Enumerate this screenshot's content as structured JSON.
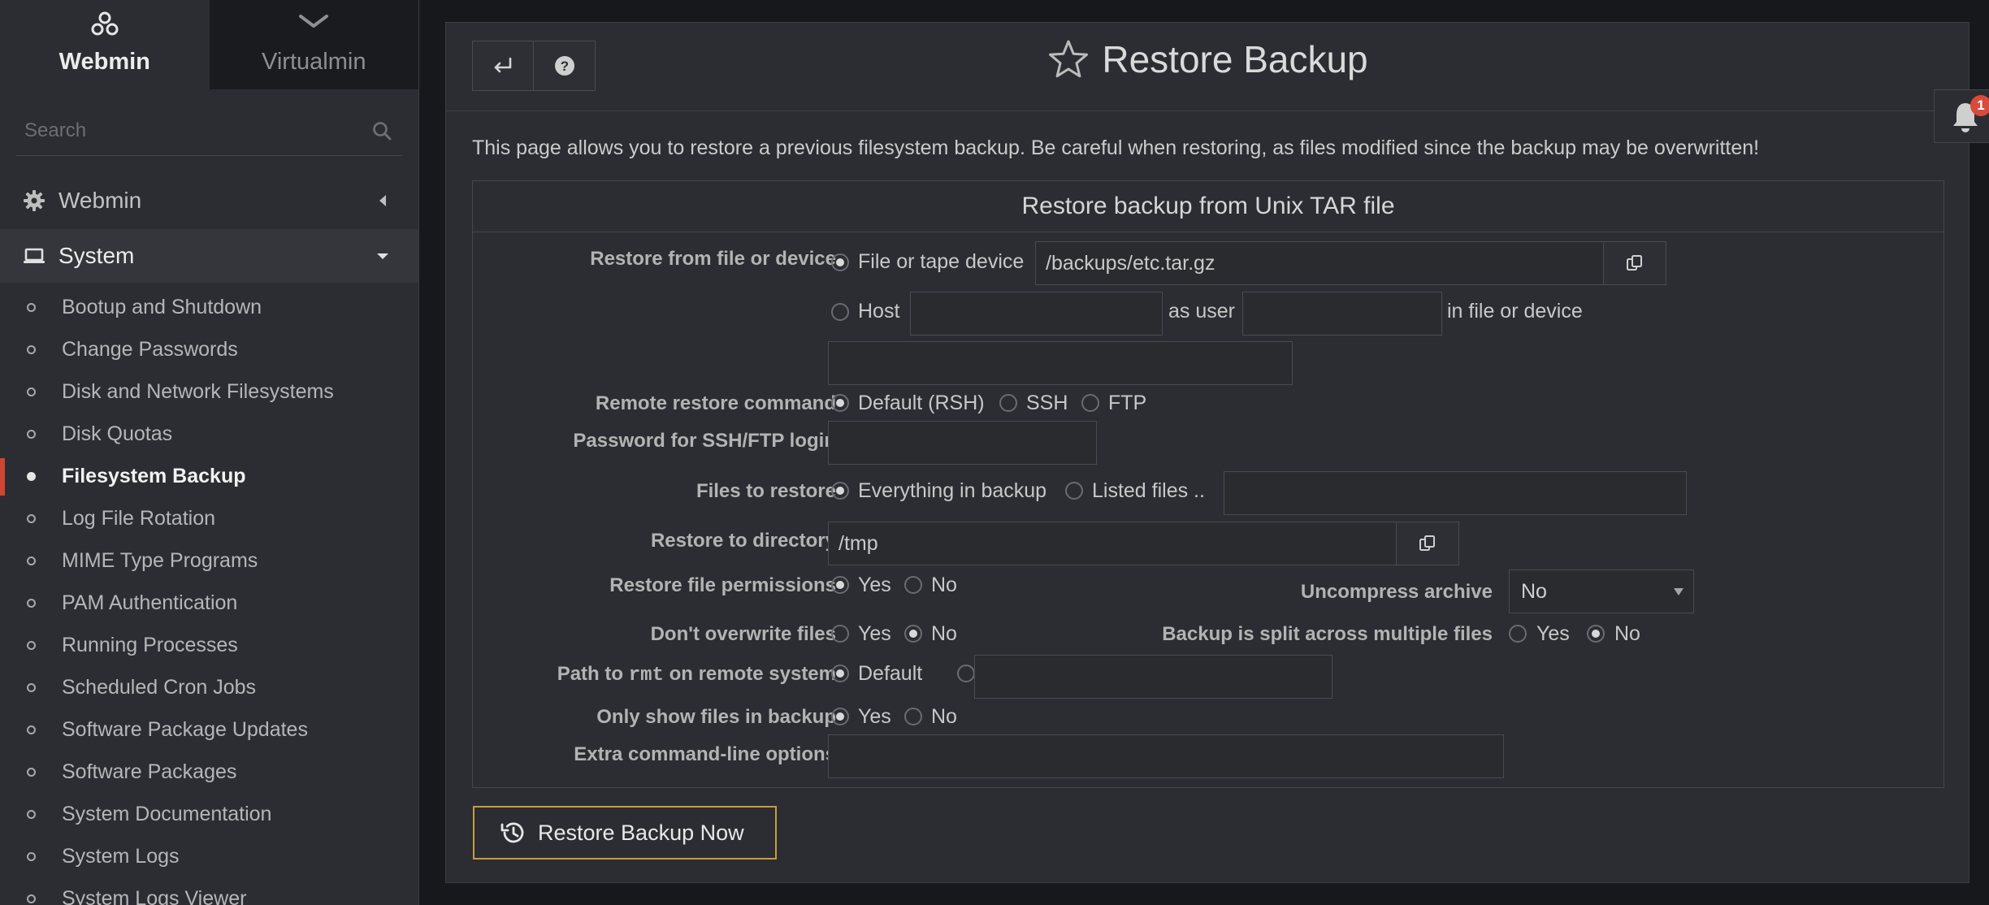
{
  "switcher": {
    "webmin_label": "Webmin",
    "virtualmin_label": "Virtualmin"
  },
  "search": {
    "placeholder": "Search"
  },
  "nav": {
    "webmin_label": "Webmin",
    "system_label": "System",
    "items": [
      {
        "label": "Bootup and Shutdown"
      },
      {
        "label": "Change Passwords"
      },
      {
        "label": "Disk and Network Filesystems"
      },
      {
        "label": "Disk Quotas"
      },
      {
        "label": "Filesystem Backup",
        "active": true
      },
      {
        "label": "Log File Rotation"
      },
      {
        "label": "MIME Type Programs"
      },
      {
        "label": "PAM Authentication"
      },
      {
        "label": "Running Processes"
      },
      {
        "label": "Scheduled Cron Jobs"
      },
      {
        "label": "Software Package Updates"
      },
      {
        "label": "Software Packages"
      },
      {
        "label": "System Documentation"
      },
      {
        "label": "System Logs"
      },
      {
        "label": "System Logs Viewer"
      }
    ]
  },
  "page": {
    "title": "Restore Backup",
    "description": "This page allows you to restore a previous filesystem backup. Be careful when restoring, as files modified since the backup may be overwritten!",
    "section_title": "Restore backup from Unix TAR file"
  },
  "form": {
    "restore_from": {
      "label": "Restore from file or device",
      "file_option": "File or tape device",
      "file_value": "/backups/etc.tar.gz",
      "host_option": "Host",
      "host_value": "",
      "as_user_label": "as user",
      "user_value": "",
      "in_file_label": "in file or device",
      "remote_file_value": ""
    },
    "remote_command": {
      "label": "Remote restore command",
      "opt_default": "Default (RSH)",
      "opt_ssh": "SSH",
      "opt_ftp": "FTP",
      "selected": "Default (RSH)"
    },
    "password": {
      "label": "Password for SSH/FTP login",
      "value": ""
    },
    "files_to_restore": {
      "label": "Files to restore",
      "opt_everything": "Everything in backup",
      "opt_listed": "Listed files ..",
      "listed_value": "",
      "selected": "Everything in backup"
    },
    "restore_dir": {
      "label": "Restore to directory",
      "value": "/tmp"
    },
    "permissions": {
      "label": "Restore file permissions",
      "yes": "Yes",
      "no": "No",
      "selected": "Yes"
    },
    "uncompress": {
      "label": "Uncompress archive",
      "value": "No"
    },
    "dont_overwrite": {
      "label": "Don't overwrite files",
      "yes": "Yes",
      "no": "No",
      "selected": "No"
    },
    "split": {
      "label": "Backup is split across multiple files",
      "yes": "Yes",
      "no": "No",
      "selected": "No"
    },
    "rmt_path": {
      "label_pre": "Path to ",
      "label_code": "rmt",
      "label_post": " on remote system",
      "opt_default": "Default",
      "value": ""
    },
    "only_show": {
      "label": "Only show files in backup",
      "yes": "Yes",
      "no": "No",
      "selected": "Yes"
    },
    "extra_options": {
      "label": "Extra command-line options",
      "value": ""
    }
  },
  "actions": {
    "restore_now": "Restore Backup Now"
  },
  "notifications": {
    "count": "1"
  },
  "colors": {
    "accent": "#c69d3a",
    "active_marker": "#d0452f",
    "badge": "#d84a3b"
  }
}
